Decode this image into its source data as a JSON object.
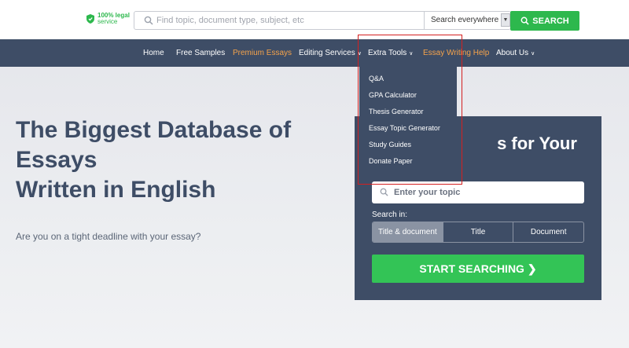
{
  "topbar": {
    "legal_line1": "100% legal",
    "legal_line2": "service",
    "search_placeholder": "Find topic, document type, subject, etc",
    "scope_value": "Search everywhere",
    "search_button": "SEARCH"
  },
  "nav": {
    "items": [
      {
        "label": "Home"
      },
      {
        "label": "Free Samples"
      },
      {
        "label": "Premium Essays"
      },
      {
        "label": "Editing Services"
      },
      {
        "label": "Extra Tools"
      },
      {
        "label": "Essay Writing Help"
      },
      {
        "label": "About Us"
      }
    ]
  },
  "dropdown": {
    "items": [
      "Q&A",
      "GPA Calculator",
      "Thesis Generator",
      "Essay Topic Generator",
      "Study Guides",
      "Donate Paper"
    ]
  },
  "hero": {
    "title_line1": "The Biggest Database of",
    "title_line2": "Essays",
    "title_line3": "Written in English",
    "subtitle": "Are you on a tight deadline with your essay?"
  },
  "panel": {
    "title_visible": "s for Your",
    "input_placeholder": "Enter your topic",
    "search_in_label": "Search in:",
    "segments": [
      "Title & document",
      "Title",
      "Document"
    ],
    "start_button": "START SEARCHING"
  },
  "colors": {
    "navy": "#3e4d66",
    "green": "#2db84d",
    "orange": "#f5a34b",
    "highlight": "#d42020"
  }
}
